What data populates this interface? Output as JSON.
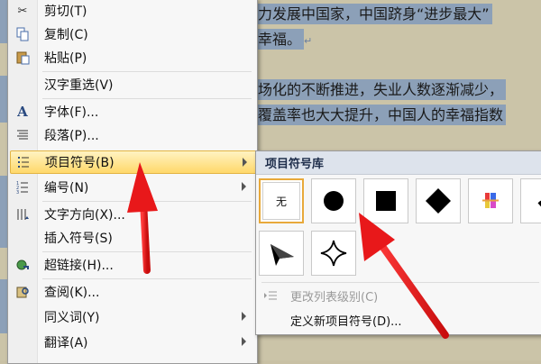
{
  "document": {
    "line1": "力发展中国家，中国跻身“进步最大”",
    "line2": "幸福。",
    "line3": "场化的不断推进，失业人数逐渐减少，",
    "line4": "覆盖率也大大提升，中国人的幸福指数",
    "para_mark": "↵"
  },
  "context_menu": {
    "items": [
      {
        "label": "剪切(T)",
        "icon": "scissors-icon"
      },
      {
        "label": "复制(C)",
        "icon": "copy-icon"
      },
      {
        "label": "粘贴(P)",
        "icon": "paste-icon"
      },
      {
        "label": "汉字重选(V)",
        "icon": ""
      },
      {
        "label": "字体(F)...",
        "icon": "font-icon"
      },
      {
        "label": "段落(P)...",
        "icon": "paragraph-icon"
      },
      {
        "label": "项目符号(B)",
        "icon": "bullets-icon",
        "submenu": true,
        "highlighted": true
      },
      {
        "label": "编号(N)",
        "icon": "numbering-icon",
        "submenu": true
      },
      {
        "label": "文字方向(X)...",
        "icon": "text-direction-icon"
      },
      {
        "label": "插入符号(S)",
        "icon": ""
      },
      {
        "label": "超链接(H)...",
        "icon": "hyperlink-icon"
      },
      {
        "label": "查阅(K)...",
        "icon": "lookup-icon"
      },
      {
        "label": "同义词(Y)",
        "icon": "",
        "submenu": true
      },
      {
        "label": "翻译(A)",
        "icon": "",
        "submenu": true
      }
    ]
  },
  "bullet_library": {
    "title": "项目符号库",
    "none_label": "无",
    "symbols": [
      "none",
      "filled-circle",
      "filled-square",
      "filled-diamond",
      "four-color-diamond",
      "check-mark",
      "arrowhead",
      "four-point-star"
    ],
    "change_level_label": "更改列表级别(C)",
    "define_new_label": "定义新项目符号(D)..."
  },
  "colors": {
    "highlight": "#ffd86a",
    "selected_border": "#e8a93a",
    "annotation_arrow": "#e8181a",
    "text_selection": "#8ca0b8"
  }
}
